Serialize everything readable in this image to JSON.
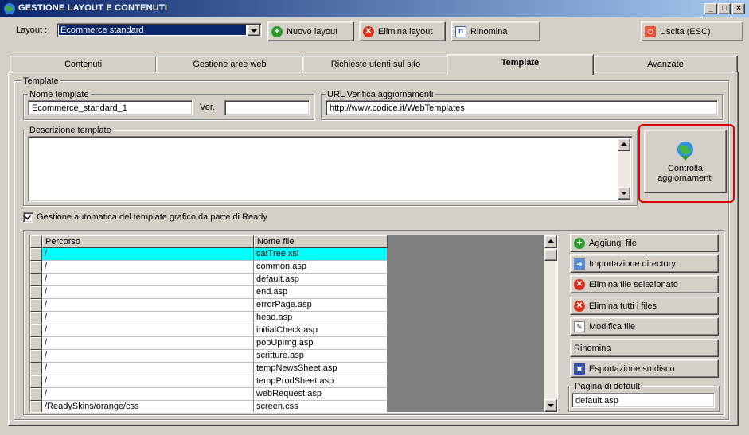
{
  "window": {
    "title": "GESTIONE LAYOUT E CONTENUTI",
    "buttons": [
      "_",
      "□",
      "×"
    ]
  },
  "toolbar": {
    "layout_label": "Layout :",
    "layout_value": "Ecommerce standard",
    "new_layout": "Nuovo layout",
    "delete_layout": "Elimina layout",
    "rename": "Rinomina",
    "exit": "Uscita (ESC)"
  },
  "tabs": [
    {
      "label": "Contenuti"
    },
    {
      "label": "Gestione aree web"
    },
    {
      "label": "Richieste utenti sul sito"
    },
    {
      "label": "Template"
    },
    {
      "label": "Avanzate"
    }
  ],
  "template": {
    "group_label": "Template",
    "name_group_label": "Nome template",
    "name_value": "Ecommerce_standard_1",
    "ver_label": "Ver.",
    "ver_value": "",
    "url_group_label": "URL Verifica aggiornamenti",
    "url_value": "http://www.codice.it/WebTemplates",
    "desc_group_label": "Descrizione template",
    "desc_value": "",
    "check_updates_line1": "Controlla",
    "check_updates_line2": "aggiornamenti",
    "auto_manage_label": "Gestione automatica del template grafico da parte di Ready",
    "auto_manage_checked": true
  },
  "grid": {
    "columns": [
      "Percorso",
      "Nome file"
    ],
    "rows": [
      [
        "/",
        "catTree.xsl"
      ],
      [
        "/",
        "common.asp"
      ],
      [
        "/",
        "default.asp"
      ],
      [
        "/",
        "end.asp"
      ],
      [
        "/",
        "errorPage.asp"
      ],
      [
        "/",
        "head.asp"
      ],
      [
        "/",
        "initialCheck.asp"
      ],
      [
        "/",
        "popUpImg.asp"
      ],
      [
        "/",
        "scritture.asp"
      ],
      [
        "/",
        "tempNewsSheet.asp"
      ],
      [
        "/",
        "tempProdSheet.asp"
      ],
      [
        "/",
        "webRequest.asp"
      ],
      [
        "/ReadySkins/orange/css",
        "screen.css"
      ]
    ],
    "selected_row": 0
  },
  "actions": {
    "add_file": "Aggiungi file",
    "import_dir": "Importazione directory",
    "delete_selected": "Elimina file selezionato",
    "delete_all": "Elimina tutti i files",
    "edit_file": "Modifica file",
    "rename": "Rinomina",
    "export": "Esportazione su disco",
    "default_page_label": "Pagina di default",
    "default_page_value": "default.asp"
  },
  "colors": {
    "selection": "#00ffff",
    "title_start": "#0a246a",
    "title_end": "#a6caf0",
    "highlight_outline": "#e00000"
  }
}
